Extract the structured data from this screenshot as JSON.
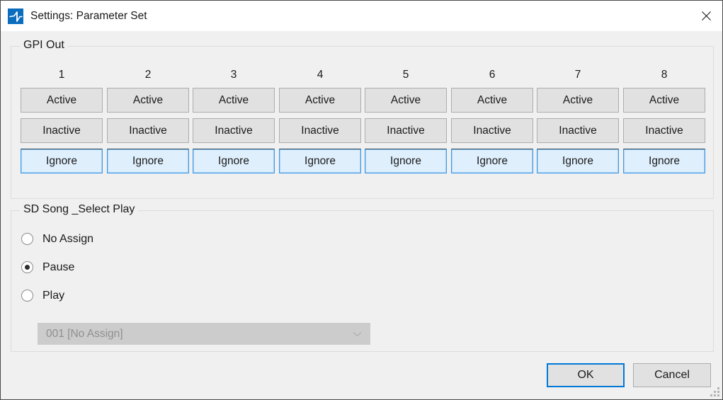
{
  "window": {
    "title": "Settings: Parameter Set",
    "app_icon": "waveform-icon",
    "close_icon": "close-icon",
    "resize_grip": "resize-grip-icon",
    "accent_color": "#0078d7",
    "titlebar_bg": "#ffffff",
    "body_bg": "#f0f0f0"
  },
  "gpi_out": {
    "legend": "GPI Out",
    "columns": [
      {
        "number": "1",
        "buttons": [
          {
            "label": "Active",
            "selected": false
          },
          {
            "label": "Inactive",
            "selected": false
          },
          {
            "label": "Ignore",
            "selected": true
          }
        ]
      },
      {
        "number": "2",
        "buttons": [
          {
            "label": "Active",
            "selected": false
          },
          {
            "label": "Inactive",
            "selected": false
          },
          {
            "label": "Ignore",
            "selected": true
          }
        ]
      },
      {
        "number": "3",
        "buttons": [
          {
            "label": "Active",
            "selected": false
          },
          {
            "label": "Inactive",
            "selected": false
          },
          {
            "label": "Ignore",
            "selected": true
          }
        ]
      },
      {
        "number": "4",
        "buttons": [
          {
            "label": "Active",
            "selected": false
          },
          {
            "label": "Inactive",
            "selected": false
          },
          {
            "label": "Ignore",
            "selected": true
          }
        ]
      },
      {
        "number": "5",
        "buttons": [
          {
            "label": "Active",
            "selected": false
          },
          {
            "label": "Inactive",
            "selected": false
          },
          {
            "label": "Ignore",
            "selected": true
          }
        ]
      },
      {
        "number": "6",
        "buttons": [
          {
            "label": "Active",
            "selected": false
          },
          {
            "label": "Inactive",
            "selected": false
          },
          {
            "label": "Ignore",
            "selected": true
          }
        ]
      },
      {
        "number": "7",
        "buttons": [
          {
            "label": "Active",
            "selected": false
          },
          {
            "label": "Inactive",
            "selected": false
          },
          {
            "label": "Ignore",
            "selected": true
          }
        ]
      },
      {
        "number": "8",
        "buttons": [
          {
            "label": "Active",
            "selected": false
          },
          {
            "label": "Inactive",
            "selected": false
          },
          {
            "label": "Ignore",
            "selected": true
          }
        ]
      }
    ],
    "selected_color": "#bfdffa",
    "selected_border_color": "#3d9ae8"
  },
  "sd_song_select_play": {
    "legend": "SD Song _Select Play",
    "options": [
      {
        "label": "No Assign",
        "checked": false
      },
      {
        "label": "Pause",
        "checked": true
      },
      {
        "label": "Play",
        "checked": false
      }
    ],
    "song_dropdown": {
      "value": "001 [No Assign]",
      "disabled": true,
      "chevron_icon": "chevron-down-icon"
    }
  },
  "footer": {
    "ok_label": "OK",
    "cancel_label": "Cancel"
  }
}
